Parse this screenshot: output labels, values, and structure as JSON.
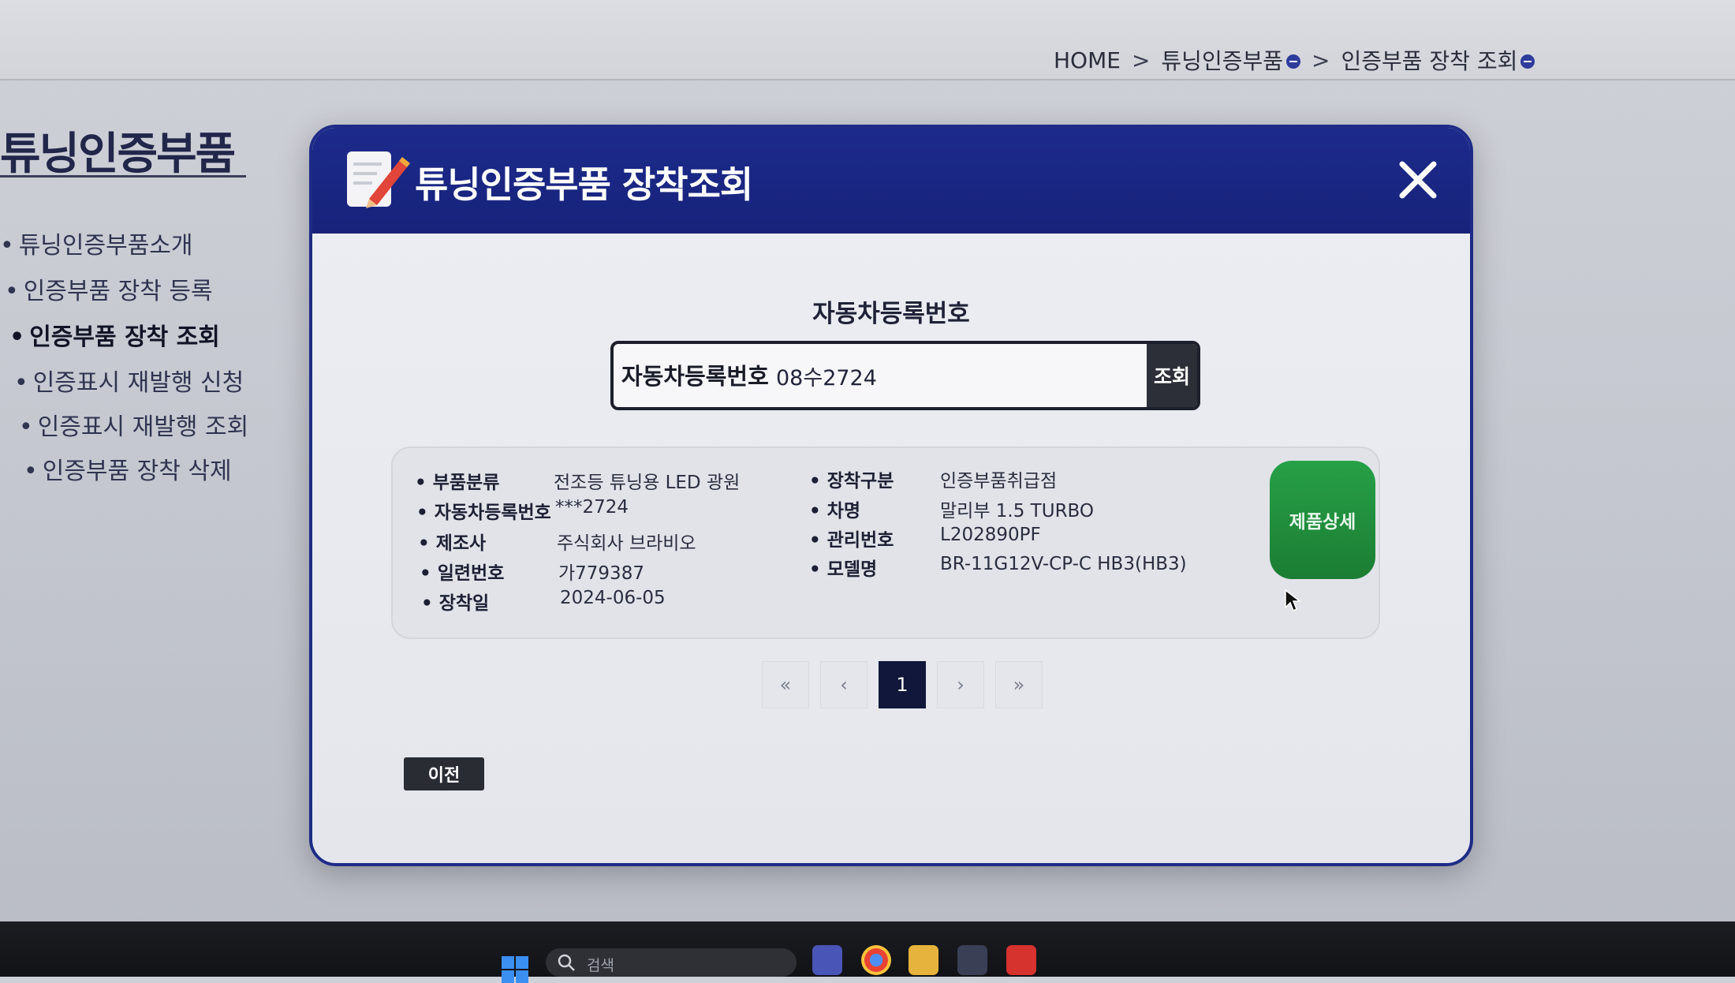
{
  "breadcrumb": {
    "home": "HOME",
    "separator": ">",
    "level1": "튜닝인증부품",
    "level2": "인증부품 장착 조회"
  },
  "sidebar": {
    "title": "튜닝인증부품",
    "bullet": "•",
    "items": [
      {
        "label": "튜닝인증부품소개"
      },
      {
        "label": "인증부품 장착 등록"
      },
      {
        "label": "인증부품 장착 조회"
      },
      {
        "label": "인증표시 재발행 신청"
      },
      {
        "label": "인증표시 재발행 조회"
      },
      {
        "label": "인증부품 장착 삭제"
      }
    ]
  },
  "modal": {
    "title": "튜닝인증부품 장착조회",
    "section_label": "자동차등록번호",
    "search": {
      "label": "자동차등록번호",
      "value": "08수2724",
      "button": "조회"
    },
    "result": {
      "left": [
        {
          "key": "부품분류",
          "value": "전조등 튜닝용 LED 광원"
        },
        {
          "key": "자동차등록번호",
          "value": "***2724"
        },
        {
          "key": "제조사",
          "value": "주식회사 브라비오"
        },
        {
          "key": "일련번호",
          "value": "가779387"
        },
        {
          "key": "장착일",
          "value": "2024-06-05"
        }
      ],
      "right": [
        {
          "key": "장착구분",
          "value": "인증부품취급점"
        },
        {
          "key": "차명",
          "value": "말리부 1.5 TURBO"
        },
        {
          "key": "관리번호",
          "value": "L202890PF"
        },
        {
          "key": "모델명",
          "value": "BR-11G12V-CP-C HB3(HB3)"
        }
      ],
      "detail_button": "제품상세"
    },
    "pagination": {
      "first": "«",
      "prev": "‹",
      "current": "1",
      "next": "›",
      "last": "»"
    },
    "prev_button": "이전"
  },
  "taskbar": {
    "search_placeholder": "검색"
  },
  "colors": {
    "modal_header": "#1c2a8c",
    "detail_button": "#1f8a3a",
    "active_page": "#10173a"
  },
  "icons": [
    "document-pencil-icon",
    "close-icon",
    "search-icon",
    "windows-logo-icon",
    "cursor-icon"
  ]
}
